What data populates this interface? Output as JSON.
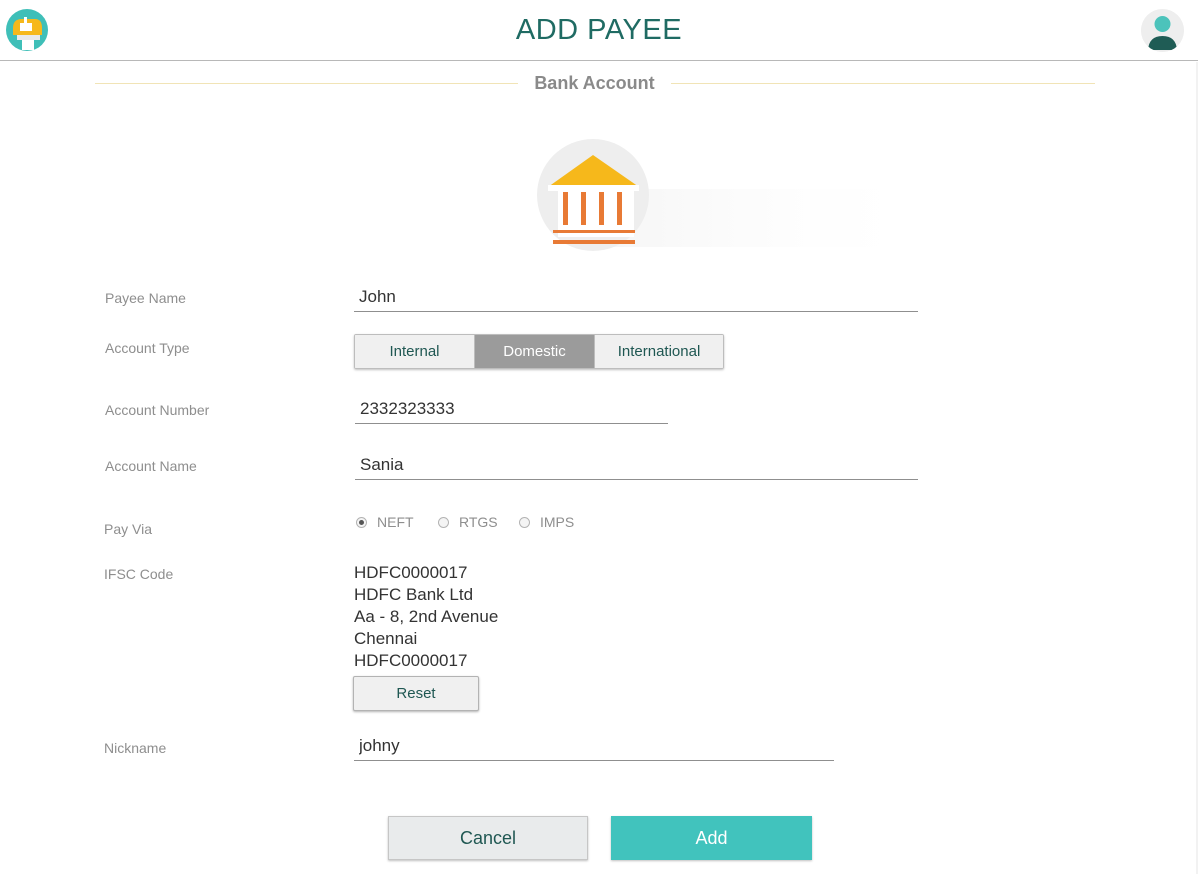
{
  "header": {
    "title": "ADD PAYEE",
    "logo_icon": "mailbox-icon",
    "avatar_icon": "user-avatar-icon"
  },
  "section": {
    "title": "Bank Account",
    "icon": "bank-icon"
  },
  "form": {
    "payee_name": {
      "label": "Payee Name",
      "value": "John"
    },
    "account_type": {
      "label": "Account Type",
      "options": [
        "Internal",
        "Domestic",
        "International"
      ],
      "selected": "Domestic"
    },
    "account_number": {
      "label": "Account Number",
      "value": "2332323333"
    },
    "account_name": {
      "label": "Account Name",
      "value": "Sania"
    },
    "pay_via": {
      "label": "Pay Via",
      "options": [
        "NEFT",
        "RTGS",
        "IMPS"
      ],
      "selected": "NEFT"
    },
    "ifsc": {
      "label": "IFSC Code",
      "lines": [
        "HDFC0000017",
        "HDFC Bank Ltd",
        "Aa - 8, 2nd Avenue",
        "Chennai",
        "HDFC0000017"
      ],
      "reset_label": "Reset"
    },
    "nickname": {
      "label": "Nickname",
      "value": "johny"
    }
  },
  "actions": {
    "cancel_label": "Cancel",
    "add_label": "Add"
  },
  "colors": {
    "title": "#1f6b63",
    "accent": "#41c3bd",
    "bank_roof": "#f6b81b",
    "bank_pillars": "#e87a35",
    "segment_active": "#9b9b9b"
  }
}
